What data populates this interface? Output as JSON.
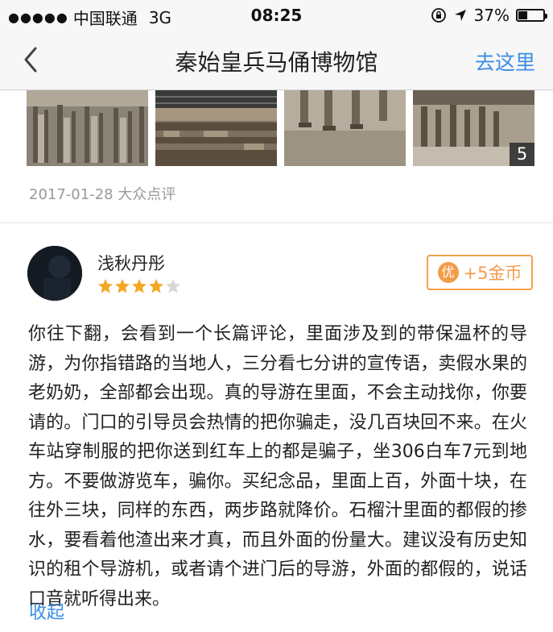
{
  "status_bar": {
    "carrier": "中国联通",
    "network": "3G",
    "time": "08:25",
    "battery": "37%",
    "battery_level": 0.37
  },
  "nav": {
    "title": "秦始皇兵马俑博物馆",
    "action": "去这里"
  },
  "gallery": {
    "photo_count": "5",
    "meta": "2017-01-28 大众点评"
  },
  "review": {
    "user_name": "浅秋丹彤",
    "rating": 4,
    "rating_max": 5,
    "coin_icon_text": "优",
    "coin_reward": "+5金币",
    "text": "你往下翻，会看到一个长篇评论，里面涉及到的带保温杯的导游，为你指错路的当地人，三分看七分讲的宣传语，卖假水果的老奶奶，全部都会出现。真的导游在里面，不会主动找你，你要请的。门口的引导员会热情的把你骗走，没几百块回不来。在火车站穿制服的把你送到红车上的都是骗子，坐306白车7元到地方。不要做游览车，骗你。买纪念品，里面上百，外面十块，在往外三块，同样的东西，两步路就降价。石榴汁里面的都假的掺水，要看着他渣出来才真，而且外面的份量大。建议没有历史知识的租个导游机，或者请个进门后的导游，外面的都假的，说话口音就听得出来。",
    "collapse_label": "收起"
  },
  "colors": {
    "accent_blue": "#3a8ee6",
    "star_gold": "#f5a623",
    "coin_orange": "#f39c4a"
  }
}
